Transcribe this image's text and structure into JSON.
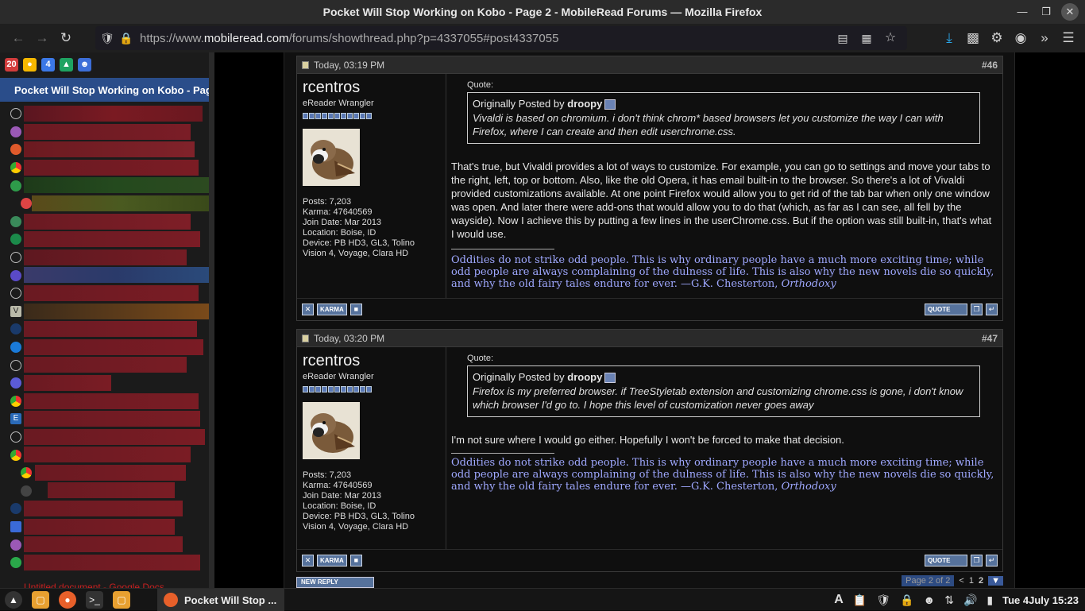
{
  "window": {
    "title": "Pocket Will Stop Working on Kobo - Page 2 - MobileRead Forums — Mozilla Firefox"
  },
  "navbar": {
    "url_prefix": "https://www.",
    "url_domain": "mobileread.com",
    "url_path": "/forums/showthread.php?p=4337055#post4337055"
  },
  "sidebar": {
    "active_tab": "Pocket Will Stop Working on Kobo - Pag",
    "last_tab": "Untitled document - Google Docs"
  },
  "posts": [
    {
      "date": "Today, 03:19 PM",
      "number": "#46",
      "username": "rcentros",
      "user_title": "eReader Wrangler",
      "posts": "Posts: 7,203",
      "karma": "Karma: 47640569",
      "join": "Join Date: Mar 2013",
      "location": "Location: Boise, ID",
      "device": "Device: PB HD3, GL3, Tolino Vision 4, Voyage, Clara HD",
      "quote_label": "Quote:",
      "quote_prefix": "Originally Posted by",
      "quote_author": "droopy",
      "quote_text": "Vivaldi is based on chromium. i don't think chrom* based browsers let you customize the way I can with Firefox, where I can create and then edit userchrome.css.",
      "message": "That's true, but Vivaldi provides a lot of ways to customize. For example, you can go to settings and move your tabs to the right, left, top or bottom. Also, like the old Opera, it has email built-in to the browser. So there's a lot of Vivaldi provided customizations available. At one point Firefox would allow you to get rid of the tab bar when only one window was open. And later there were add-ons that would allow you to do that (which, as far as I can see, all fell by the wayside). Now I achieve this by putting a few lines in the userChrome.css. But if the option was still built-in, that's what I would use.",
      "signature": "Oddities do not strike odd people. This is why ordinary people have a much more exciting time; while odd people are always complaining of the dulness of life. This is also why the new novels die so quickly, and why the old fairy tales endure for ever. —G.K. Chesterton,",
      "signature_book": "Orthodoxy"
    },
    {
      "date": "Today, 03:20 PM",
      "number": "#47",
      "username": "rcentros",
      "user_title": "eReader Wrangler",
      "posts": "Posts: 7,203",
      "karma": "Karma: 47640569",
      "join": "Join Date: Mar 2013",
      "location": "Location: Boise, ID",
      "device": "Device: PB HD3, GL3, Tolino Vision 4, Voyage, Clara HD",
      "quote_label": "Quote:",
      "quote_prefix": "Originally Posted by",
      "quote_author": "droopy",
      "quote_text": "Firefox is my preferred browser. if TreeStyletab extension and customizing chrome.css is gone, i don't know which browser I'd go to. I hope this level of customization never goes away",
      "message": "I'm not sure where I would go either. Hopefully I won't be forced to make that decision.",
      "signature": "Oddities do not strike odd people. This is why ordinary people have a much more exciting time; while odd people are always complaining of the dulness of life. This is also why the new novels die so quickly, and why the old fairy tales endure for ever. —G.K. Chesterton,",
      "signature_book": "Orthodoxy"
    }
  ],
  "buttons": {
    "karma": "KARMA",
    "quote": "QUOTE",
    "new_reply": "NEW REPLY"
  },
  "pager": {
    "label": "Page 2 of 2",
    "prev": "<",
    "page1": "1",
    "page2": "2"
  },
  "taskbar": {
    "task_label": "Pocket Will Stop ...",
    "clock": "Tue  4July  15:23"
  }
}
